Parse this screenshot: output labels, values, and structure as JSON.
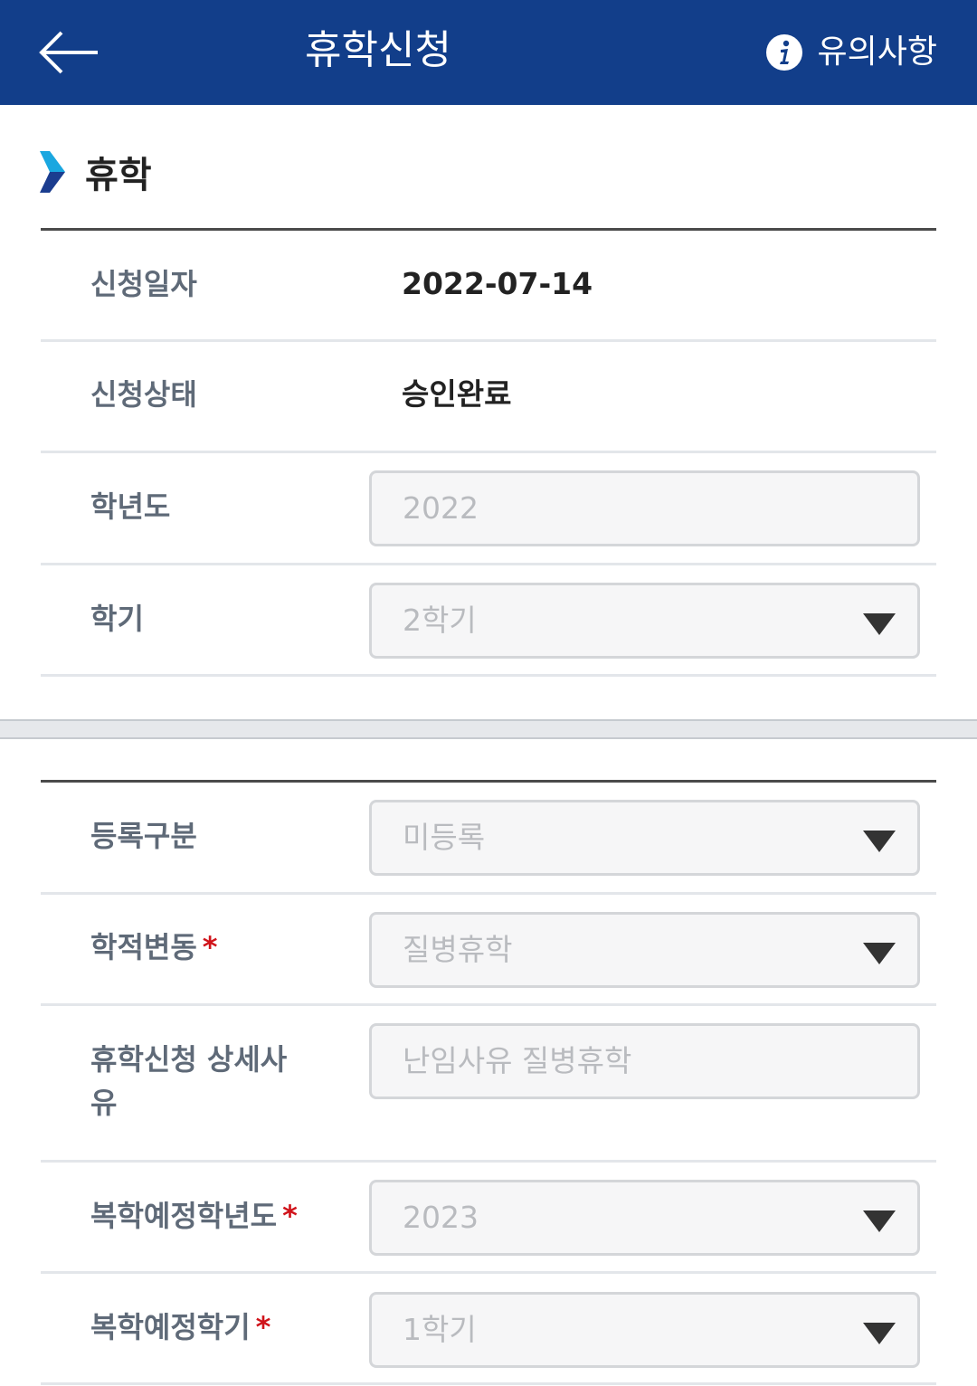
{
  "header": {
    "title": "휴학신청",
    "notice_label": "유의사항",
    "color": "#123e8a"
  },
  "section": {
    "title": "휴학"
  },
  "info": {
    "apply_date_label": "신청일자",
    "apply_date_value": "2022-07-14",
    "status_label": "신청상태",
    "status_value": "승인완료",
    "year_label": "학년도",
    "year_value": "2022",
    "semester_label": "학기",
    "semester_value": "2학기"
  },
  "form": {
    "registration_label": "등록구분",
    "registration_value": "미등록",
    "status_change_label": "학적변동",
    "status_change_value": "질병휴학",
    "detail_reason_label_line1": "휴학신청 상세사",
    "detail_reason_label_line2": "유",
    "detail_reason_value": "난임사유 질병휴학",
    "return_year_label": "복학예정학년도",
    "return_year_value": "2023",
    "return_semester_label": "복학예정학기",
    "return_semester_value": "1학기",
    "required_mark": "*",
    "required_color": "#d0141b"
  }
}
